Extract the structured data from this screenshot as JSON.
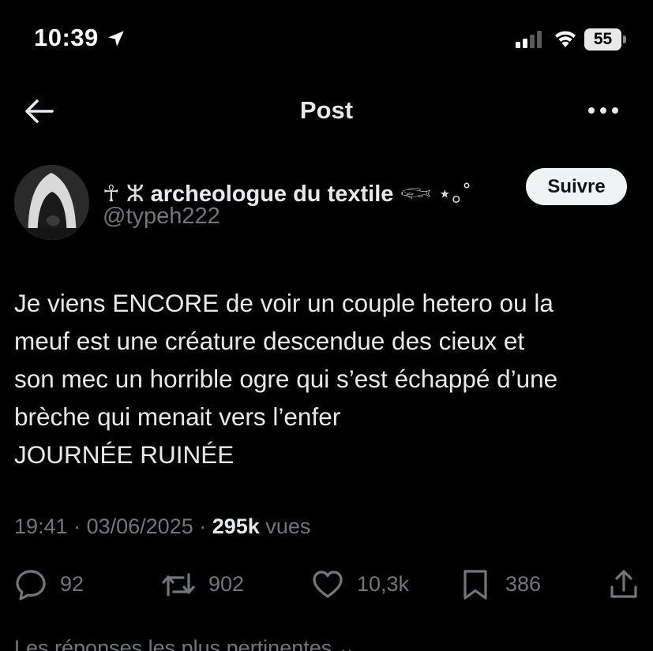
{
  "status_bar": {
    "time": "10:39",
    "battery": "55"
  },
  "header": {
    "title": "Post"
  },
  "author": {
    "name_prefix": "☥ ⵣ ",
    "name": "archeologue du textile",
    "name_suffix": " 𓆟 ⋆｡˚",
    "handle": "@typeh222",
    "follow_label": "Suivre"
  },
  "tweet": {
    "lines": [
      "Je viens ENCORE de voir un couple hetero ou la",
      "meuf est une créature descendue des cieux et",
      "son mec un horrible ogre qui s’est échappé d’une",
      "brèche qui menait vers l’enfer",
      "JOURNÉE RUINÉE"
    ],
    "time": "19:41",
    "date": "03/06/2025",
    "views": "295k",
    "views_label": "vues"
  },
  "actions": {
    "replies": "92",
    "reposts": "902",
    "likes": "10,3k",
    "bookmarks": "386"
  },
  "footer": {
    "replies_sort_label": "Les réponses les plus pertinentes"
  },
  "colors": {
    "background": "#000000",
    "text": "#e7e9ea",
    "muted": "#71767b",
    "follow_bg": "#eff3f4"
  }
}
